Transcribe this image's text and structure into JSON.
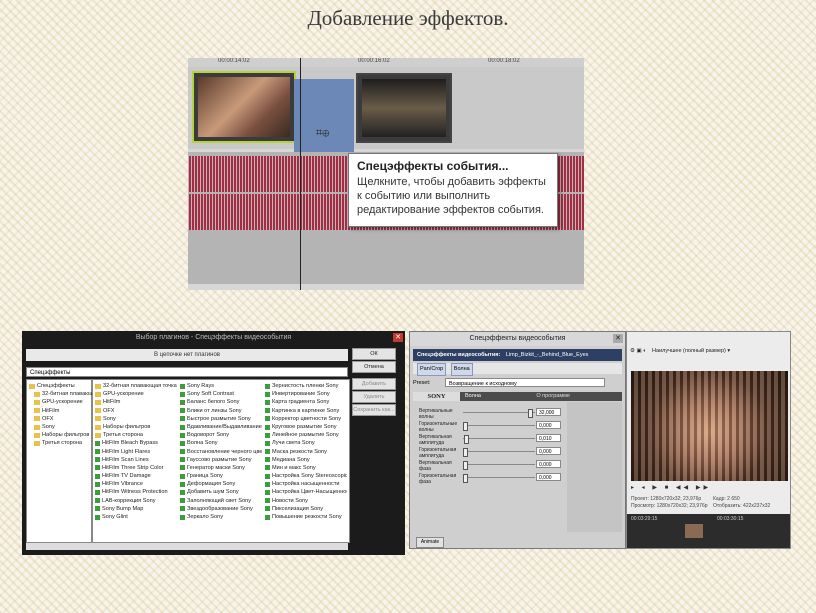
{
  "slide": {
    "title": "Добавление эффектов."
  },
  "timeline": {
    "ruler_marks": [
      "00:00:14:02",
      "00:00:16:02",
      "00:00:18:02"
    ],
    "tooltip_title": "Спецэффекты события...",
    "tooltip_body": "Щелкните, чтобы добавить эффекты к событию или выполнить редактирование эффектов события."
  },
  "plugin_chooser": {
    "title": "Выбор плагинов - Спецэффекты видеособытия",
    "path_header": "В цепочке нет плагинов",
    "address": "Спецэффекты",
    "tree": [
      "Спецэффекты",
      "32-битная плавающая",
      "GPU-ускорение",
      "HitFilm",
      "OFX",
      "Sony",
      "Наборы фильтров",
      "Третья сторона"
    ],
    "col1": [
      "32-битная плавающая точка",
      "GPU-ускорение",
      "HitFilm",
      "OFX",
      "Sony",
      "Наборы фильтров",
      "Третья сторона",
      "HitFilm Bleach Bypass",
      "HitFilm Light Flares",
      "HitFilm Scan Lines",
      "HitFilm Three Strip Color",
      "HitFilm TV Damage",
      "HitFilm Vibrance",
      "HitFilm Witness Protection",
      "LAB-коррекция Sony",
      "Sony Bump Map",
      "Sony Glint"
    ],
    "col2": [
      "Sony Rays",
      "Sony Soft Contrast",
      "Баланс белого Sony",
      "Блики от линзы Sony",
      "Быстрое размытие Sony",
      "Вдавливание/Выдавливание Sony",
      "Водоворот Sony",
      "Волна Sony",
      "Восстановление черного цвета Sony",
      "Гауссово размытие Sony",
      "Генератор маски Sony",
      "Граница Sony",
      "Деформация Sony",
      "Добавить шум Sony",
      "Заполняющий свет Sony",
      "Звездообразование Sony",
      "Зеркало Sony"
    ],
    "col3": [
      "Зернистость пленки Sony",
      "Инвертирование Sony",
      "Карта градиента Sony",
      "Картинка в картинке Sony",
      "Корректор цветности Sony",
      "Круговое размытие Sony",
      "Линейное размытие Sony",
      "Лучи света Sony",
      "Маска резкости Sony",
      "Медиана Sony",
      "Мин и макс Sony",
      "Настройка Sony Stereoscopic",
      "Настройка насыщенности",
      "Настройка Цвет-Насыщенность",
      "Новости Sony",
      "Пикселизация Sony",
      "Повышение резкости Sony"
    ],
    "buttons": {
      "ok": "ОК",
      "cancel": "Отмена",
      "add": "Добавить",
      "remove": "Удалить",
      "save_as": "Сохранить как..."
    }
  },
  "effects_dialog": {
    "title": "Спецэффекты видеособытия",
    "chain_label": "Спецэффекты видеособытия:",
    "chain_clip": "Limp_Bizkit_-_Behind_Blue_Eyes",
    "chain_items": [
      "Pan/Crop",
      "Волна"
    ],
    "preset_label": "Preset:",
    "preset_value": "Возвращение к исходному",
    "brand": "SONY",
    "plugin_name": "Волна",
    "about": "О программе",
    "params": [
      {
        "label": "Вертикальные волны",
        "value": "32,000",
        "level": 0.95
      },
      {
        "label": "Горизонтальные волны",
        "value": "0,000",
        "level": 0.0
      },
      {
        "label": "Вертикальная амплитуда",
        "value": "0,010",
        "level": 0.02
      },
      {
        "label": "Горизонтальная амплитуда",
        "value": "0,000",
        "level": 0.0
      },
      {
        "label": "Вертикальная фаза",
        "value": "0,000",
        "level": 0.0
      },
      {
        "label": "Горизонтальная фаза",
        "value": "0,000",
        "level": 0.0
      }
    ],
    "animate": "Animate"
  },
  "preview": {
    "quality": "Наилучшее (полный размер)",
    "info_labels": [
      "Проект:",
      "Просмотр:",
      "Кадр:",
      "Отобразить:"
    ],
    "info_values": [
      "1280x720x32; 23,976p",
      "1280x720x32; 23,976p",
      "2 650",
      "422x237x32"
    ],
    "times": [
      "00:03:29:15",
      "00:03:30:15"
    ]
  }
}
